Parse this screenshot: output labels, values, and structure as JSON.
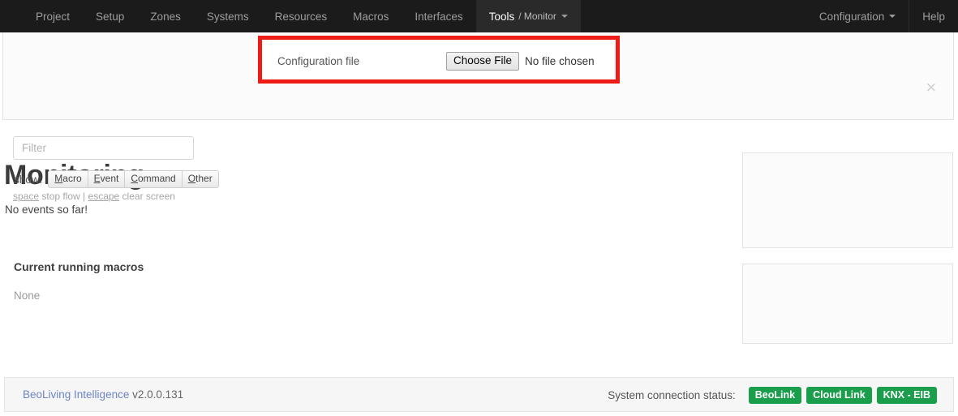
{
  "navbar": {
    "left_items": [
      {
        "label": "Project",
        "active": false
      },
      {
        "label": "Setup",
        "active": false
      },
      {
        "label": "Zones",
        "active": false
      },
      {
        "label": "Systems",
        "active": false
      },
      {
        "label": "Resources",
        "active": false
      },
      {
        "label": "Macros",
        "active": false
      },
      {
        "label": "Interfaces",
        "active": false
      }
    ],
    "active_item": {
      "label": "Tools",
      "sub_label": "/ Monitor",
      "caret": "chevron-down-icon"
    },
    "right_items": [
      {
        "label": "Configuration",
        "caret": "chevron-down-icon"
      },
      {
        "label": "Help",
        "caret": null
      }
    ]
  },
  "alert": {
    "upload_label": "Configuration file",
    "choose_file_label": "Choose File",
    "no_file_text": "No file chosen",
    "close_label": "×",
    "highlight_color": "#ed1c16"
  },
  "main": {
    "title": "Monitoring",
    "empty_message": "No events so far!"
  },
  "sidebar": {
    "filter_panel": {
      "filter_placeholder": "Filter",
      "filter_value": "",
      "show_label": "show:",
      "show_buttons": [
        {
          "accel": "M",
          "rest": "acro"
        },
        {
          "accel": "E",
          "rest": "vent"
        },
        {
          "accel": "C",
          "rest": "ommand"
        },
        {
          "accel": "O",
          "rest": "ther"
        }
      ],
      "hint": {
        "key1": "space",
        "text1": " stop flow | ",
        "key2": "escape",
        "text2": " clear screen"
      }
    },
    "macros_panel": {
      "heading": "Current running macros",
      "value": "None"
    }
  },
  "footer": {
    "product_link": "BeoLiving Intelligence",
    "version": "v2.0.0.131",
    "status_label": "System connection status:",
    "badges": [
      {
        "label": "BeoLink",
        "color": "#1a9e4b"
      },
      {
        "label": "Cloud Link",
        "color": "#1a9e4b"
      },
      {
        "label": "KNX - EIB",
        "color": "#1a9e4b"
      }
    ]
  }
}
